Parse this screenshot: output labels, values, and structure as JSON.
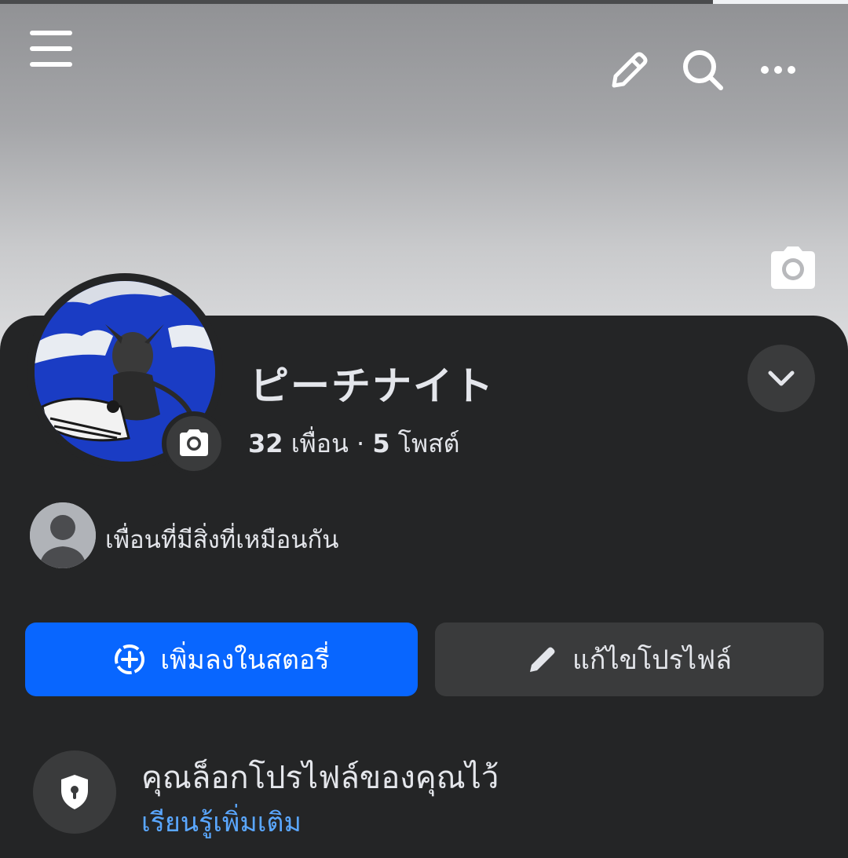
{
  "header": {
    "menu_icon": "hamburger-menu-icon",
    "edit_icon": "pencil-icon",
    "search_icon": "search-icon",
    "more_icon": "more-horizontal-icon"
  },
  "cover": {
    "camera_icon": "camera-icon"
  },
  "profile": {
    "name": "ピーチナイト",
    "friends_count": "32",
    "friends_label": "เพื่อน",
    "separator": "·",
    "posts_count": "5",
    "posts_label": "โพสต์",
    "avatar_camera_icon": "camera-icon",
    "dropdown_icon": "chevron-down-icon"
  },
  "mutual": {
    "text": "เพื่อนที่มีสิ่งที่เหมือนกัน"
  },
  "actions": {
    "add_story_label": "เพิ่มลงในสตอรี่",
    "edit_profile_label": "แก้ไขโปรไฟล์"
  },
  "locked": {
    "title": "คุณล็อกโปรไฟล์ของคุณไว้",
    "learn_more": "เรียนรู้เพิ่มเติม",
    "icon": "shield-lock-icon"
  },
  "colors": {
    "background": "#242526",
    "primary_button": "#0866ff",
    "secondary_button": "#3a3b3c",
    "link": "#5aa7ff",
    "text": "#e4e6eb"
  }
}
